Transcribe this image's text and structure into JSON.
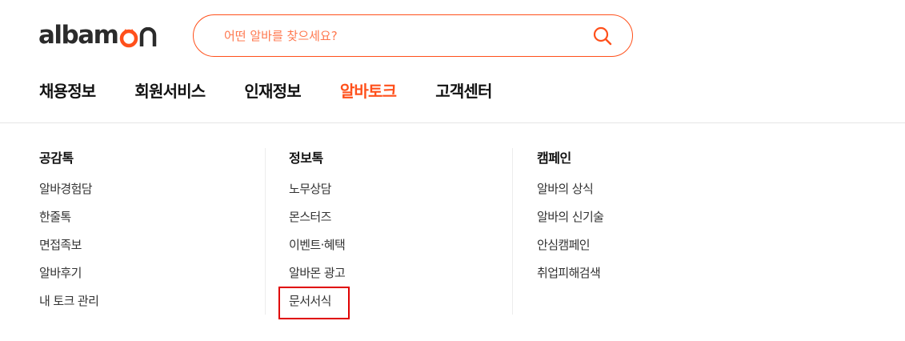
{
  "header": {
    "logo": {
      "text": "albam",
      "mark": "on"
    },
    "search": {
      "placeholder": "어떤 알바를 찾으세요?",
      "value": "",
      "button_icon": "search-icon"
    },
    "nav": [
      {
        "label": "채용정보",
        "active": false
      },
      {
        "label": "회원서비스",
        "active": false
      },
      {
        "label": "인재정보",
        "active": false
      },
      {
        "label": "알바토크",
        "active": true
      },
      {
        "label": "고객센터",
        "active": false
      }
    ]
  },
  "dropdown": {
    "columns": [
      {
        "title": "공감톡",
        "items": [
          "알바경험담",
          "한줄톡",
          "면접족보",
          "알바후기",
          "내 토크 관리"
        ]
      },
      {
        "title": "정보톡",
        "items": [
          "노무상담",
          "몬스터즈",
          "이벤트·혜택",
          "알바몬 광고",
          "문서서식"
        ]
      },
      {
        "title": "캠페인",
        "items": [
          "알바의 상식",
          "알바의 신기술",
          "안심캠페인",
          "취업피해검색"
        ]
      }
    ],
    "highlighted_item": "문서서식"
  },
  "colors": {
    "accent": "#ff501b",
    "text": "#222222",
    "highlight_box": "#e00000",
    "divider": "#ececec"
  }
}
